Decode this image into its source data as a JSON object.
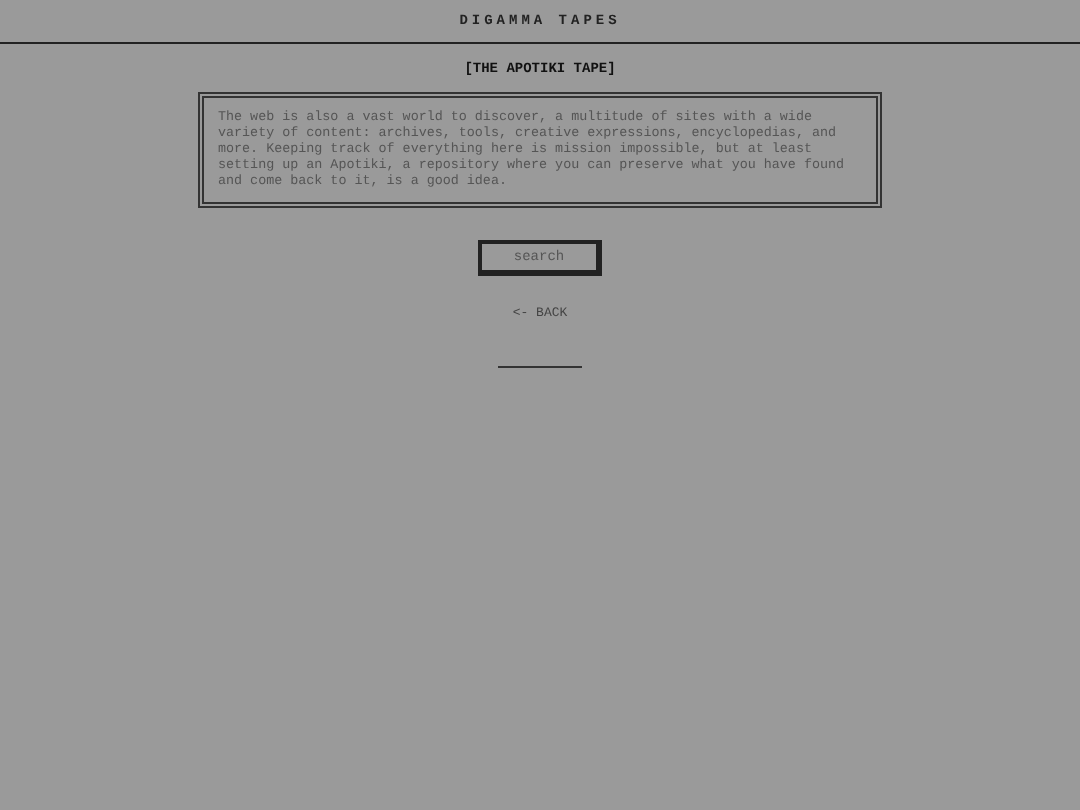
{
  "header": {
    "title": "DIGAMMA TAPES"
  },
  "page": {
    "heading": "[THE APOTIKI TAPE]",
    "description": "The web is also a vast world to discover, a multitude of sites with a wide variety of content: archives, tools, creative expressions, encyclopedias, and more. Keeping track of everything here is mission impossible, but at least setting up an Apotiki, a repository where you can preserve what you have found and come back to it, is a good idea.",
    "search_button": "search",
    "back_link": "<- BACK"
  }
}
